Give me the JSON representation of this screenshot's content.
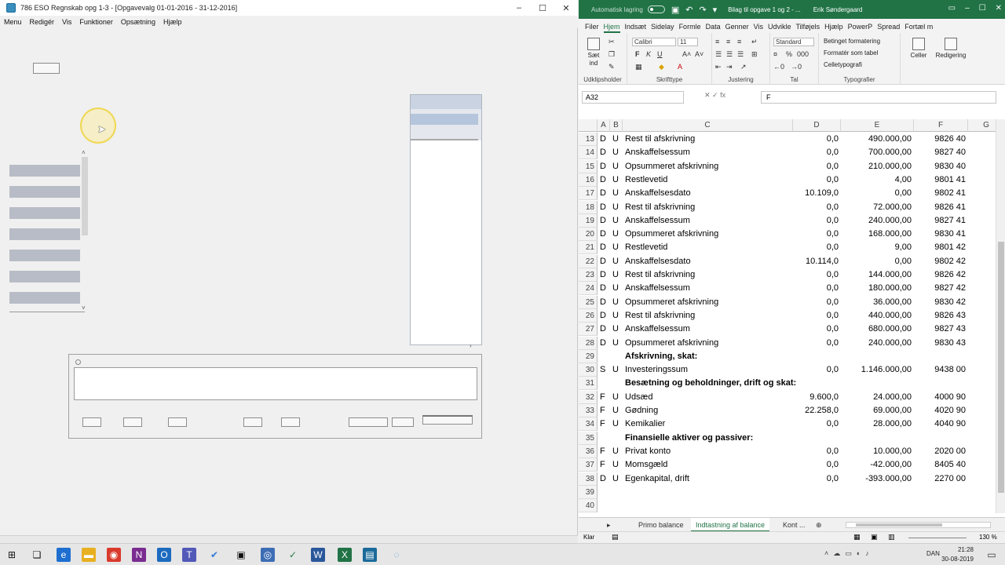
{
  "left_window": {
    "title": "786 ESO Regnskab opg 1-3 - [Opgavevalg 01-01-2016 - 31-12-2016]",
    "menu": [
      "Menu",
      "Redigér",
      "Vis",
      "Funktioner",
      "Opsætning",
      "Hjælp"
    ],
    "controls": {
      "minimize": "–",
      "maximize": "☐",
      "close": "✕"
    }
  },
  "excel": {
    "quick_access": {
      "autosave_label": "Automatisk lagring"
    },
    "document_title": "Bilag til opgave 1 og 2 - ...",
    "user": "Erik Søndergaard",
    "ribbon_tabs": [
      "Filer",
      "Hjem",
      "Indsæt",
      "Sidelay",
      "Formle",
      "Data",
      "Genner",
      "Vis",
      "Udvikle",
      "Tilføjels",
      "Hjælp",
      "PowerP",
      "Spread",
      "Fortæl m"
    ],
    "active_tab": "Hjem",
    "ribbon": {
      "clipboard": {
        "paste": "Sæt ind",
        "label": "Udklipsholder"
      },
      "font": {
        "name": "Calibri",
        "size": "11",
        "label": "Skrifttype"
      },
      "alignment": {
        "label": "Justering"
      },
      "number": {
        "format": "Standard",
        "label": "Tal"
      },
      "styles": {
        "conditional": "Betinget formatering",
        "table": "Formatér som tabel",
        "cell": "Celletypografi",
        "label": "Typografier"
      },
      "cells": {
        "label": "Celler"
      },
      "editing": {
        "label": "Redigering"
      }
    },
    "name_box": "A32",
    "formula_value": "F",
    "columns": [
      "A",
      "B",
      "C",
      "D",
      "E",
      "F",
      "G"
    ],
    "rows": [
      {
        "n": "13",
        "a": "D",
        "b": "U",
        "c": "Rest til afskrivning",
        "d": "0,0",
        "e": "490.000,00",
        "f": "9826 40"
      },
      {
        "n": "14",
        "a": "D",
        "b": "U",
        "c": "Anskaffelsessum",
        "d": "0,0",
        "e": "700.000,00",
        "f": "9827 40"
      },
      {
        "n": "15",
        "a": "D",
        "b": "U",
        "c": "Opsummeret afskrivning",
        "d": "0,0",
        "e": "210.000,00",
        "f": "9830 40"
      },
      {
        "n": "16",
        "a": "D",
        "b": "U",
        "c": "Restlevetid",
        "d": "0,0",
        "e": "4,00",
        "f": "9801 41"
      },
      {
        "n": "17",
        "a": "D",
        "b": "U",
        "c": "Anskaffelsesdato",
        "d": "10.109,0",
        "e": "0,00",
        "f": "9802 41"
      },
      {
        "n": "18",
        "a": "D",
        "b": "U",
        "c": "Rest til afskrivning",
        "d": "0,0",
        "e": "72.000,00",
        "f": "9826 41"
      },
      {
        "n": "19",
        "a": "D",
        "b": "U",
        "c": "Anskaffelsessum",
        "d": "0,0",
        "e": "240.000,00",
        "f": "9827 41"
      },
      {
        "n": "20",
        "a": "D",
        "b": "U",
        "c": "Opsummeret afskrivning",
        "d": "0,0",
        "e": "168.000,00",
        "f": "9830 41"
      },
      {
        "n": "21",
        "a": "D",
        "b": "U",
        "c": "Restlevetid",
        "d": "0,0",
        "e": "9,00",
        "f": "9801 42"
      },
      {
        "n": "22",
        "a": "D",
        "b": "U",
        "c": "Anskaffelsesdato",
        "d": "10.114,0",
        "e": "0,00",
        "f": "9802 42"
      },
      {
        "n": "23",
        "a": "D",
        "b": "U",
        "c": "Rest til afskrivning",
        "d": "0,0",
        "e": "144.000,00",
        "f": "9826 42"
      },
      {
        "n": "24",
        "a": "D",
        "b": "U",
        "c": "Anskaffelsessum",
        "d": "0,0",
        "e": "180.000,00",
        "f": "9827 42"
      },
      {
        "n": "25",
        "a": "D",
        "b": "U",
        "c": "Opsummeret afskrivning",
        "d": "0,0",
        "e": "36.000,00",
        "f": "9830 42"
      },
      {
        "n": "26",
        "a": "D",
        "b": "U",
        "c": "Rest til afskrivning",
        "d": "0,0",
        "e": "440.000,00",
        "f": "9826 43"
      },
      {
        "n": "27",
        "a": "D",
        "b": "U",
        "c": "Anskaffelsessum",
        "d": "0,0",
        "e": "680.000,00",
        "f": "9827 43"
      },
      {
        "n": "28",
        "a": "D",
        "b": "U",
        "c": "Opsummeret afskrivning",
        "d": "0,0",
        "e": "240.000,00",
        "f": "9830 43"
      },
      {
        "n": "29",
        "a": "",
        "b": "",
        "c": "Afskrivning, skat:",
        "d": "",
        "e": "",
        "f": "",
        "bold": true
      },
      {
        "n": "30",
        "a": "S",
        "b": "U",
        "c": "Investeringssum",
        "d": "0,0",
        "e": "1.146.000,00",
        "f": "9438 00"
      },
      {
        "n": "31",
        "a": "",
        "b": "",
        "c": "Besætning og beholdninger, drift og skat:",
        "d": "",
        "e": "",
        "f": "",
        "bold": true
      },
      {
        "n": "32",
        "a": "F",
        "b": "U",
        "c": "Udsæd",
        "d": "9.600,0",
        "e": "24.000,00",
        "f": "4000 90"
      },
      {
        "n": "33",
        "a": "F",
        "b": "U",
        "c": "Gødning",
        "d": "22.258,0",
        "e": "69.000,00",
        "f": "4020 90"
      },
      {
        "n": "34",
        "a": "F",
        "b": "U",
        "c": "Kemikalier",
        "d": "0,0",
        "e": "28.000,00",
        "f": "4040 90"
      },
      {
        "n": "35",
        "a": "",
        "b": "",
        "c": "Finansielle aktiver og passiver:",
        "d": "",
        "e": "",
        "f": "",
        "bold": true
      },
      {
        "n": "36",
        "a": "F",
        "b": "U",
        "c": "Privat konto",
        "d": "0,0",
        "e": "10.000,00",
        "f": "2020 00"
      },
      {
        "n": "37",
        "a": "F",
        "b": "U",
        "c": "Momsgæld",
        "d": "0,0",
        "e": "-42.000,00",
        "f": "8405 40"
      },
      {
        "n": "38",
        "a": "D",
        "b": "U",
        "c": "Egenkapital, drift",
        "d": "0,0",
        "e": "-393.000,00",
        "f": "2270 00"
      },
      {
        "n": "39",
        "a": "",
        "b": "",
        "c": "",
        "d": "",
        "e": "",
        "f": ""
      },
      {
        "n": "40",
        "a": "",
        "b": "",
        "c": "",
        "d": "",
        "e": "",
        "f": ""
      }
    ],
    "sheet_tabs": [
      "Primo balance",
      "Indtastning af balance",
      "Kont ..."
    ],
    "active_sheet": "Indtastning af balance",
    "status": {
      "ready": "Klar",
      "zoom": "130 %"
    }
  },
  "taskbar": {
    "language": "DAN",
    "time": "21:28",
    "date": "30-08-2019"
  }
}
